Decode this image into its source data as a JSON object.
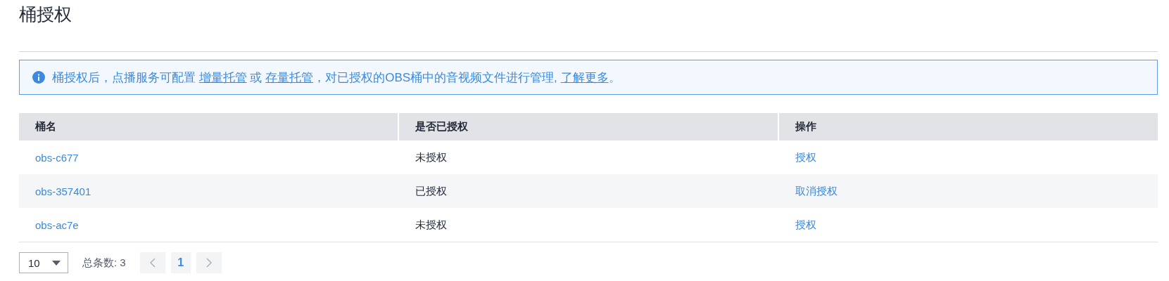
{
  "title": "桶授权",
  "info": {
    "parts": [
      {
        "kind": "text",
        "text": "桶授权后，点播服务可配置 "
      },
      {
        "kind": "link",
        "text": "增量托管"
      },
      {
        "kind": "text",
        "text": " 或 "
      },
      {
        "kind": "link",
        "text": "存量托管"
      },
      {
        "kind": "text",
        "text": "，对已授权的OBS桶中的音视频文件进行管理, "
      },
      {
        "kind": "link",
        "text": "了解更多"
      },
      {
        "kind": "text",
        "text": "。"
      }
    ]
  },
  "table": {
    "columns": [
      "桶名",
      "是否已授权",
      "操作"
    ],
    "rows": [
      {
        "name": "obs-c677",
        "status": "未授权",
        "action": "授权"
      },
      {
        "name": "obs-357401",
        "status": "已授权",
        "action": "取消授权"
      },
      {
        "name": "obs-ac7e",
        "status": "未授权",
        "action": "授权"
      }
    ]
  },
  "pagination": {
    "page_size": "10",
    "total": "总条数: 3",
    "pages": [
      {
        "label": "1",
        "selected": true
      }
    ]
  }
}
